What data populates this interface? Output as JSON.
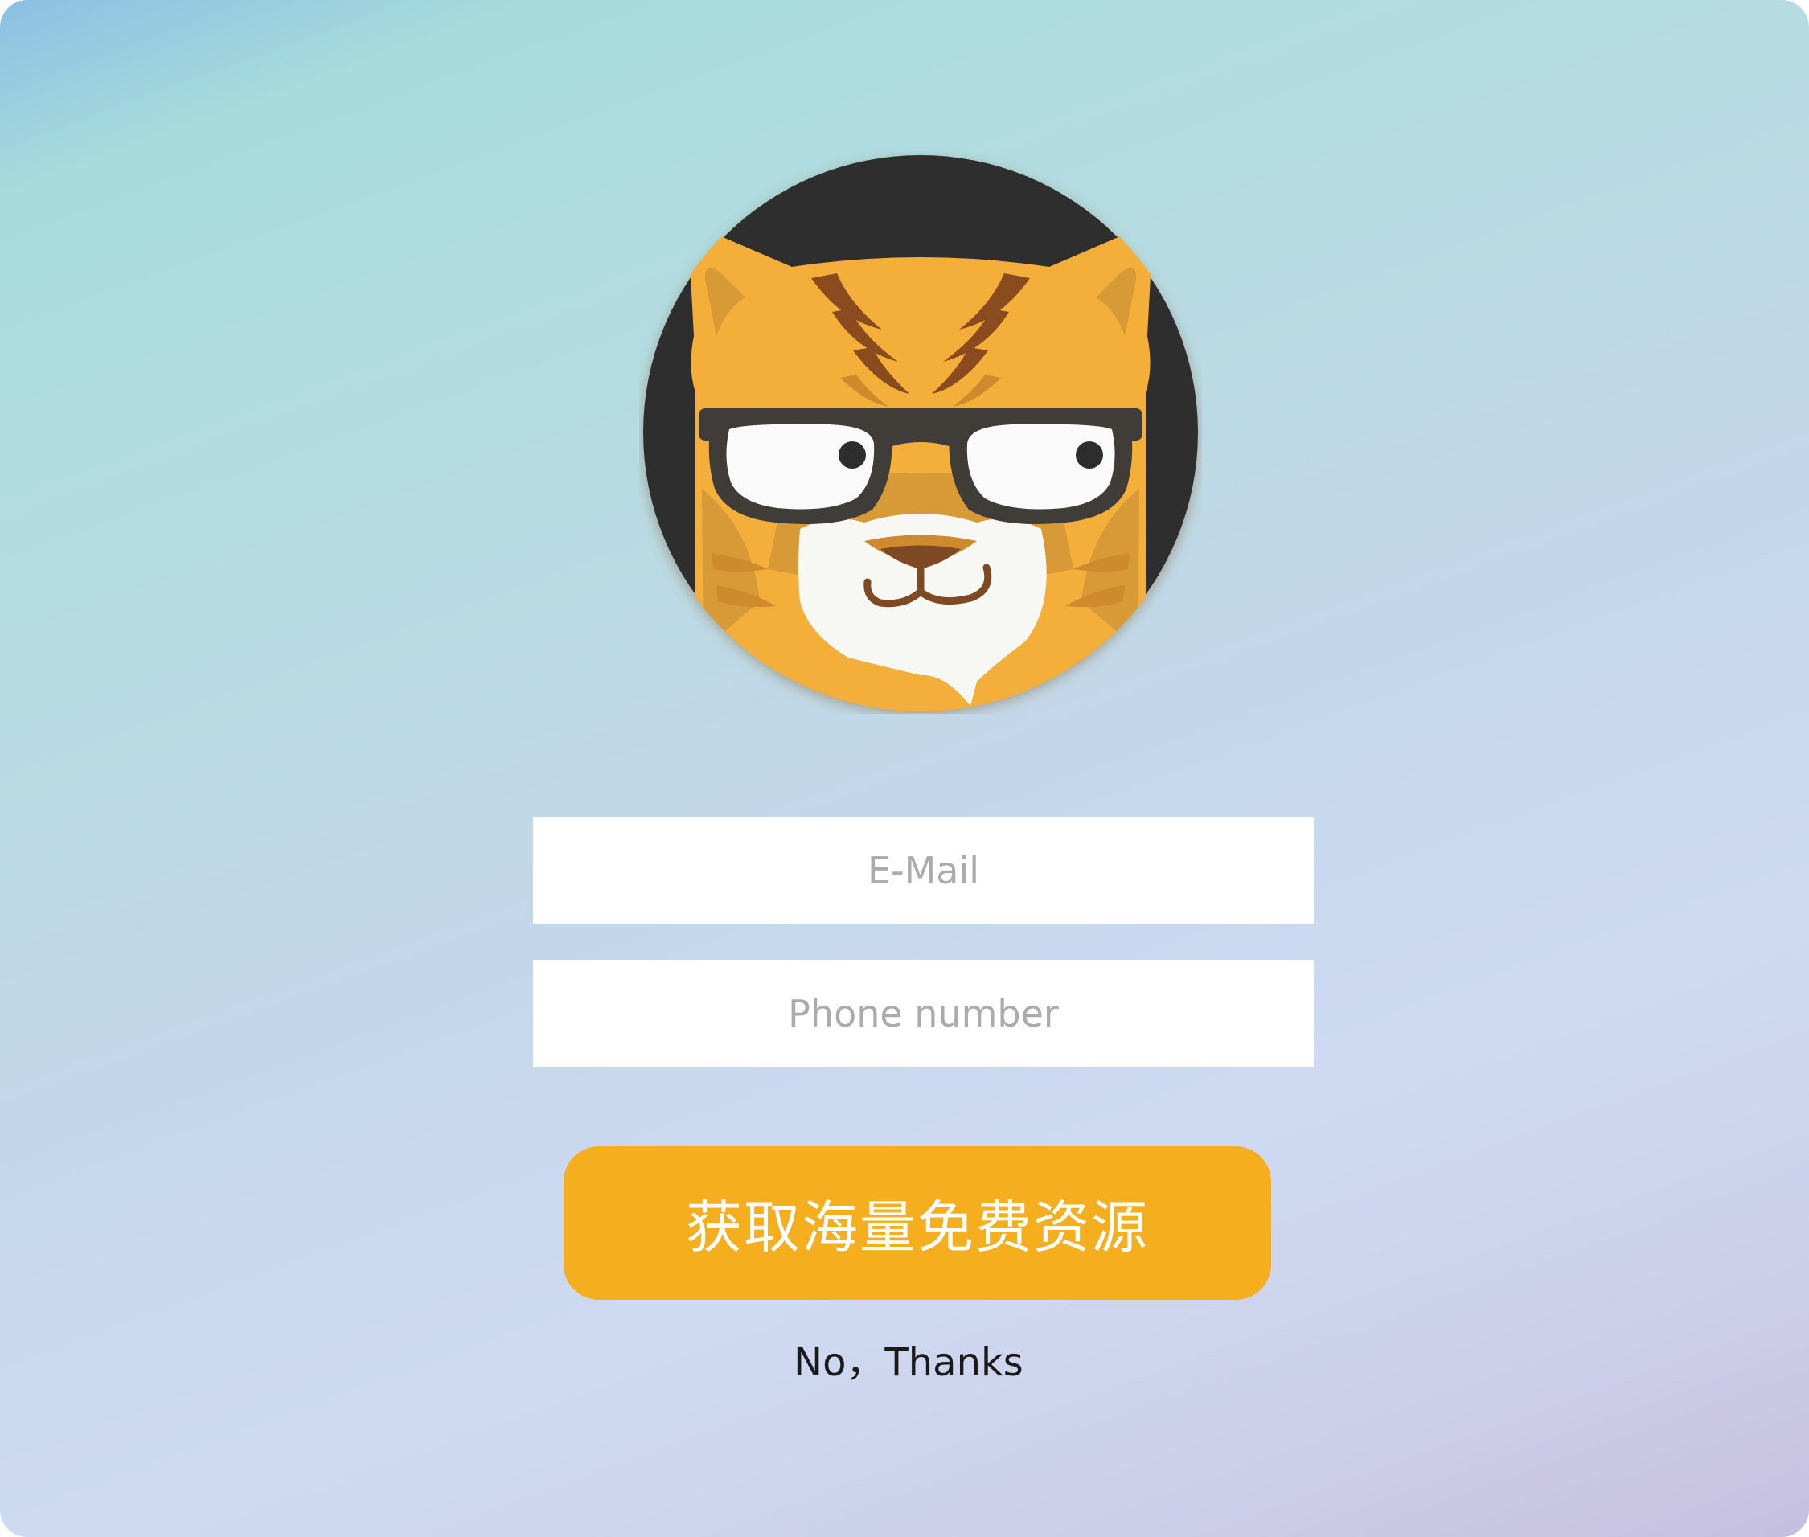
{
  "colors": {
    "button": "#f4ae1e",
    "button_text": "#ffffff",
    "field_background": "#ffffff",
    "placeholder": "#ababab",
    "avatar_background": "#2d2d2d",
    "tiger_orange": "#f4ae3a",
    "tiger_stripe": "#8a4b1e",
    "glasses_frame": "#403d38"
  },
  "logo": {
    "icon": "tiger-with-glasses-icon"
  },
  "form": {
    "email_placeholder": "E-Mail",
    "phone_placeholder": "Phone number",
    "submit_label": "获取海量免费资源",
    "dismiss_label": "No，Thanks"
  }
}
